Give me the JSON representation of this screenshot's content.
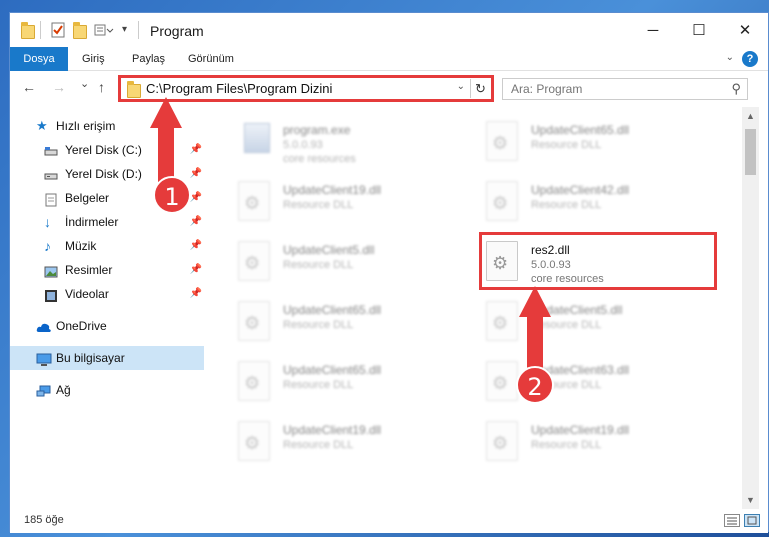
{
  "window": {
    "title": "Program"
  },
  "title_buttons": {
    "minimize": "─",
    "maximize": "☐",
    "close": "✕"
  },
  "ribbon": {
    "tabs": [
      "Dosya",
      "Giriş",
      "Paylaş",
      "Görünüm"
    ],
    "help": "?"
  },
  "nav": {
    "back": "←",
    "forward": "→",
    "recent": "⌄",
    "up": "↑",
    "address": "C:\\Program Files\\Program Dizini",
    "search_placeholder": "Ara: Program"
  },
  "sidebar": {
    "items": [
      {
        "label": "Hızlı erişim",
        "icon": "star-icon"
      },
      {
        "label": "Yerel Disk (C:)",
        "icon": "drive-icon",
        "pinned": true
      },
      {
        "label": "Yerel Disk (D:)",
        "icon": "drive-icon",
        "pinned": true
      },
      {
        "label": "Belgeler",
        "icon": "documents-icon",
        "pinned": true
      },
      {
        "label": "İndirmeler",
        "icon": "download-icon",
        "pinned": true
      },
      {
        "label": "Müzik",
        "icon": "music-icon",
        "pinned": true
      },
      {
        "label": "Resimler",
        "icon": "pictures-icon",
        "pinned": true
      },
      {
        "label": "Videolar",
        "icon": "videos-icon",
        "pinned": true
      },
      {
        "label": "OneDrive",
        "icon": "cloud-icon"
      },
      {
        "label": "Bu bilgisayar",
        "icon": "computer-icon",
        "selected": true
      },
      {
        "label": "Ağ",
        "icon": "network-icon"
      }
    ],
    "pin_glyph": "📌"
  },
  "files": [
    {
      "name": "program.exe",
      "line2": "5.0.0.93",
      "line3": "core resources"
    },
    {
      "name": "UpdateClient65.dll",
      "line2": "Resource DLL",
      "line3": ""
    },
    {
      "name": "UpdateClient19.dll",
      "line2": "Resource DLL",
      "line3": ""
    },
    {
      "name": "UpdateClient42.dll",
      "line2": "Resource DLL",
      "line3": ""
    },
    {
      "name": "UpdateClient5.dll",
      "line2": "Resource DLL",
      "line3": ""
    },
    {
      "name": "res2.dll",
      "line2": "5.0.0.93",
      "line3": "core resources"
    },
    {
      "name": "UpdateClient65.dll",
      "line2": "Resource DLL",
      "line3": ""
    },
    {
      "name": "UpdateClient5.dll",
      "line2": "Resource DLL",
      "line3": ""
    },
    {
      "name": "UpdateClient65.dll",
      "line2": "Resource DLL",
      "line3": ""
    },
    {
      "name": "UpdateClient63.dll",
      "line2": "Resource DLL",
      "line3": ""
    },
    {
      "name": "UpdateClient19.dll",
      "line2": "Resource DLL",
      "line3": ""
    },
    {
      "name": "UpdateClient19.dll",
      "line2": "Resource DLL",
      "line3": ""
    }
  ],
  "status": {
    "item_count": "185 öğe"
  },
  "annotations": {
    "step1": "1",
    "step2": "2",
    "color": "#e53b3b"
  }
}
